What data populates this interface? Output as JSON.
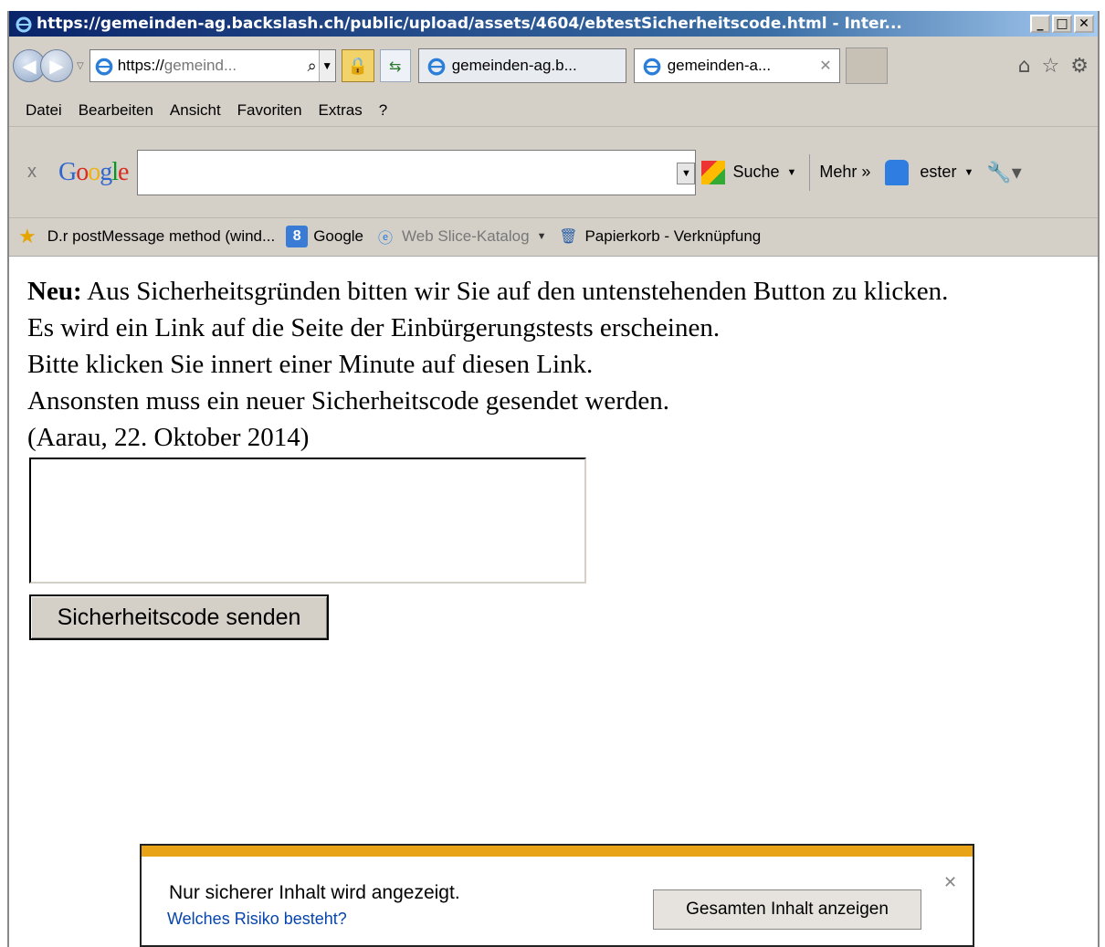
{
  "window": {
    "title": "https://gemeinden-ag.backslash.ch/public/upload/assets/4604/ebtestSicherheitscode.html - Inter...",
    "minimize": "_",
    "maximize": "□",
    "close": "✕"
  },
  "nav": {
    "address_scheme": "https://",
    "address_rest": "gemeind...",
    "search_glyph": "⌕",
    "tabs": [
      {
        "label": "gemeinden-ag.b..."
      },
      {
        "label": "gemeinden-a...",
        "close": "✕"
      }
    ],
    "icons": [
      "home-icon",
      "favorites-star-icon",
      "settings-gear-icon"
    ]
  },
  "menu": {
    "items": [
      "Datei",
      "Bearbeiten",
      "Ansicht",
      "Favoriten",
      "Extras",
      "?"
    ]
  },
  "google_toolbar": {
    "close": "x",
    "logo": "Google",
    "search_value": "",
    "search_label": "Suche",
    "more_label": "Mehr »",
    "user_label": "ester"
  },
  "favorites": {
    "items": [
      {
        "label": "D.r postMessage method (wind..."
      },
      {
        "label": "Google"
      },
      {
        "label": "Web Slice-Katalog"
      },
      {
        "label": "Papierkorb - Verknüpfung"
      }
    ]
  },
  "content": {
    "bold_prefix": "Neu:",
    "line1": " Aus Sicherheitsgründen bitten wir Sie auf den untenstehenden Button zu klicken.",
    "line2": "Es wird ein Link auf die Seite der Einbürgerungstests erscheinen.",
    "line3": "Bitte klicken Sie innert einer Minute auf diesen Link.",
    "line4": "Ansonsten muss ein neuer Sicherheitscode gesendet werden.",
    "line5": "(Aarau, 22. Oktober 2014)",
    "code_value": "",
    "send_button": "Sicherheitscode senden"
  },
  "notification": {
    "text": "Nur sicherer Inhalt wird angezeigt.",
    "link": "Welches Risiko besteht?",
    "button": "Gesamten Inhalt anzeigen",
    "close": "✕",
    "stripe_color": "#e8a317"
  }
}
